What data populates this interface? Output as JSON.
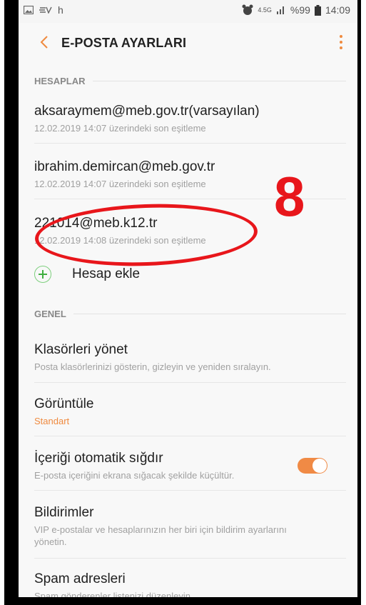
{
  "status_bar": {
    "left_icons": [
      "image-icon",
      "ev-icon"
    ],
    "left_text": "h",
    "network": "4.5G",
    "battery": "%99",
    "time": "14:09"
  },
  "app_bar": {
    "title": "E-POSTA AYARLARI"
  },
  "sections": {
    "accounts": "HESAPLAR",
    "general": "GENEL"
  },
  "accounts": [
    {
      "email": "aksaraymem@meb.gov.tr(varsayılan)",
      "sync": "12.02.2019  14:07 üzerindeki son eşitleme"
    },
    {
      "email": "ibrahim.demircan@meb.gov.tr",
      "sync": "12.02.2019  14:07 üzerindeki son eşitleme"
    },
    {
      "email": "221014@meb.k12.tr",
      "sync": "12.02.2019  14:08 üzerindeki son eşitleme"
    }
  ],
  "add_account": "Hesap ekle",
  "general_items": [
    {
      "title": "Klasörleri yönet",
      "sub": "Posta klasörlerinizi gösterin, gizleyin ve yeniden sıralayın."
    },
    {
      "title": "Görüntüle",
      "sub": "Standart"
    },
    {
      "title": "İçeriği otomatik sığdır",
      "sub": "E-posta içeriğini ekrana sığacak şekilde küçültür.",
      "toggle": true
    },
    {
      "title": "Bildirimler",
      "sub": "VIP e-postalar ve hesaplarınızın her biri için bildirim ayarlarını yönetin."
    },
    {
      "title": "Spam adresleri",
      "sub": "Spam gönderenler listenizi düzenleyin."
    }
  ],
  "annotation": {
    "number": "8",
    "color": "#e8161b"
  },
  "colors": {
    "accent": "#f08a45",
    "add_green": "#3fae3f"
  }
}
